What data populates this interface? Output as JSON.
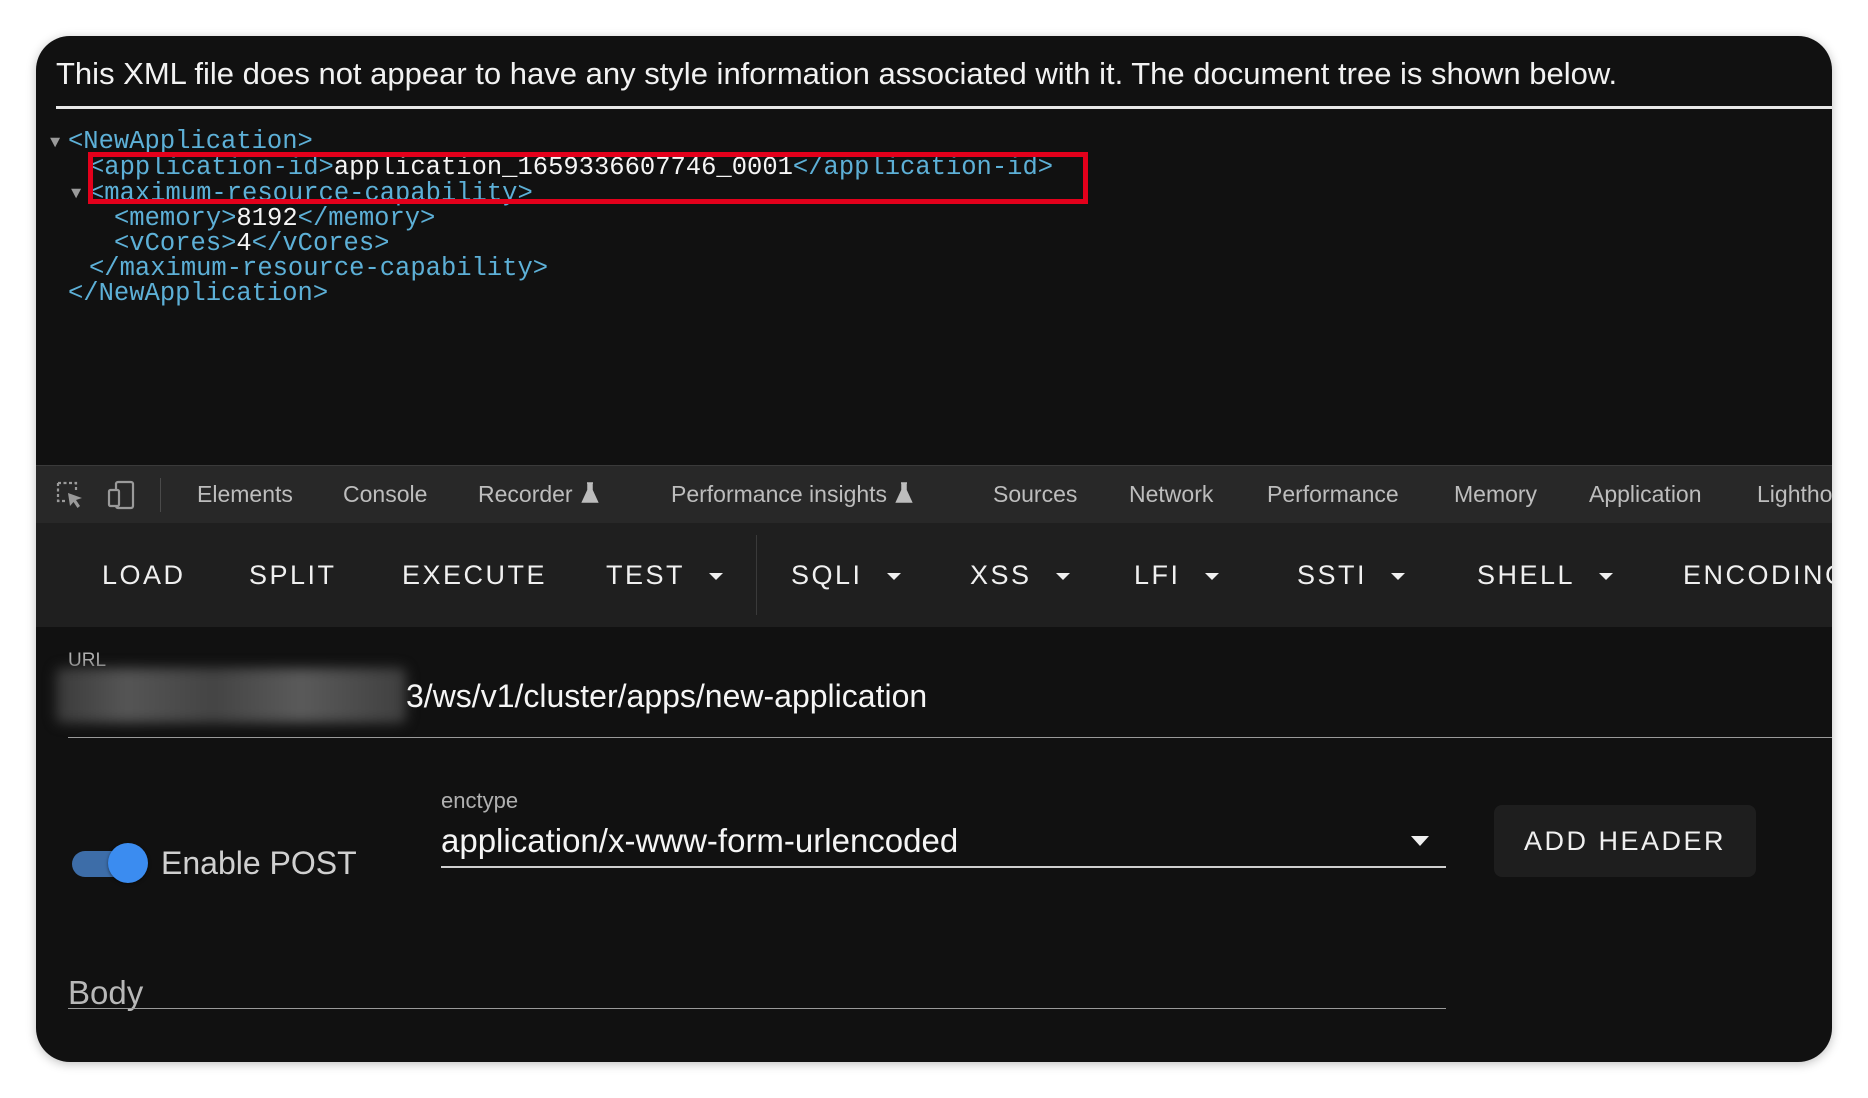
{
  "xml_viewer": {
    "notice": "This XML file does not appear to have any style information associated with it. The document tree is shown below.",
    "lines": {
      "open_root": "<NewApplication>",
      "app_id_open": "<application-id>",
      "app_id_value": "application_1659336607746_0001",
      "app_id_close": "</application-id>",
      "mrc_open": "<maximum-resource-capability>",
      "memory_open": "<memory>",
      "memory_value": "8192",
      "memory_close": "</memory>",
      "vcores_open": "<vCores>",
      "vcores_value": "4",
      "vcores_close": "</vCores>",
      "mrc_close": "</maximum-resource-capability>",
      "close_root": "</NewApplication>"
    }
  },
  "devtools": {
    "tabs": [
      "Elements",
      "Console",
      "Recorder",
      "Performance insights",
      "Sources",
      "Network",
      "Performance",
      "Memory",
      "Application",
      "Lightho"
    ]
  },
  "hackbar": {
    "buttons": [
      "LOAD",
      "SPLIT",
      "EXECUTE",
      "TEST",
      "SQLI",
      "XSS",
      "LFI",
      "SSTI",
      "SHELL",
      "ENCODING"
    ],
    "url": {
      "label": "URL",
      "value": "3/ws/v1/cluster/apps/new-application"
    },
    "enable_post": {
      "label": "Enable POST",
      "on": true
    },
    "enctype": {
      "label": "enctype",
      "value": "application/x-www-form-urlencoded"
    },
    "add_header": "ADD HEADER",
    "body": {
      "label": "Body"
    }
  },
  "colors": {
    "tag": "#5db0d7",
    "highlight": "#e3001b",
    "toggle": "#3b8cf0"
  }
}
